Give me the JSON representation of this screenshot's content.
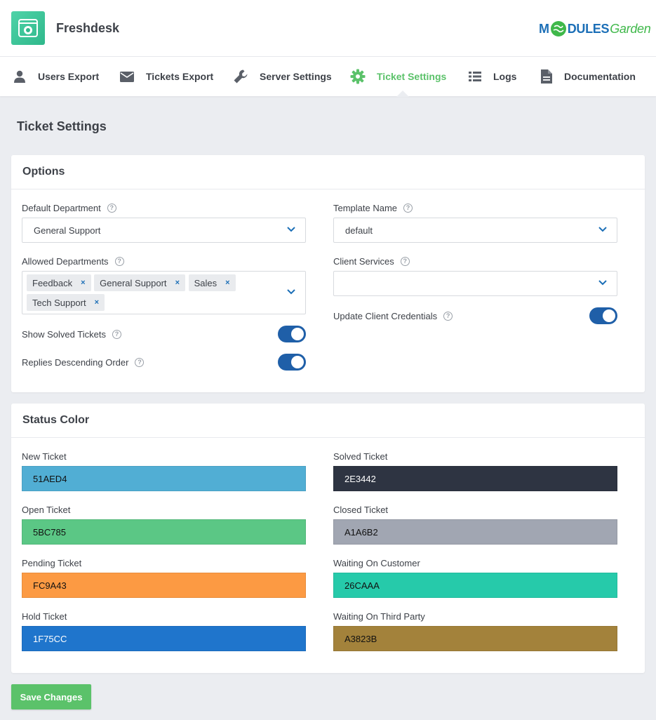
{
  "app": {
    "title": "Freshdesk"
  },
  "brand": {
    "part1": "M",
    "part2": "DULES",
    "part3": "Garden"
  },
  "nav": {
    "items": [
      {
        "label": "Users Export",
        "icon": "user-icon"
      },
      {
        "label": "Tickets Export",
        "icon": "envelope-icon"
      },
      {
        "label": "Server Settings",
        "icon": "wrench-icon"
      },
      {
        "label": "Ticket Settings",
        "icon": "gear-icon",
        "active": true
      },
      {
        "label": "Logs",
        "icon": "list-icon"
      },
      {
        "label": "Documentation",
        "icon": "document-icon"
      }
    ]
  },
  "page": {
    "title": "Ticket Settings"
  },
  "options": {
    "title": "Options",
    "default_department": {
      "label": "Default Department",
      "value": "General Support"
    },
    "template_name": {
      "label": "Template Name",
      "value": "default"
    },
    "allowed_departments": {
      "label": "Allowed Departments",
      "tags": [
        "Feedback",
        "General Support",
        "Sales",
        "Tech Support"
      ]
    },
    "client_services": {
      "label": "Client Services",
      "value": ""
    },
    "show_solved": {
      "label": "Show Solved Tickets",
      "on": true
    },
    "replies_desc": {
      "label": "Replies Descending Order",
      "on": true
    },
    "update_credentials": {
      "label": "Update Client Credentials",
      "on": true
    },
    "help_glyph": "?",
    "remove_glyph": "×"
  },
  "status_color": {
    "title": "Status Color",
    "items": [
      {
        "label": "New Ticket",
        "value": "51AED4",
        "color": "#51AED4"
      },
      {
        "label": "Solved Ticket",
        "value": "2E3442",
        "color": "#2E3442"
      },
      {
        "label": "Open Ticket",
        "value": "5BC785",
        "color": "#5BC785"
      },
      {
        "label": "Closed Ticket",
        "value": "A1A6B2",
        "color": "#A1A6B2"
      },
      {
        "label": "Pending Ticket",
        "value": "FC9A43",
        "color": "#FC9A43"
      },
      {
        "label": "Waiting On Customer",
        "value": "26CAAA",
        "color": "#26CAAA"
      },
      {
        "label": "Hold Ticket",
        "value": "1F75CC",
        "color": "#1F75CC"
      },
      {
        "label": "Waiting On Third Party",
        "value": "A3823B",
        "color": "#A3823B"
      }
    ]
  },
  "actions": {
    "save_label": "Save Changes"
  },
  "colors": {
    "accent": "#5bc26a",
    "toggle": "#1f5fa8",
    "brand_blue": "#1c6fb7"
  }
}
